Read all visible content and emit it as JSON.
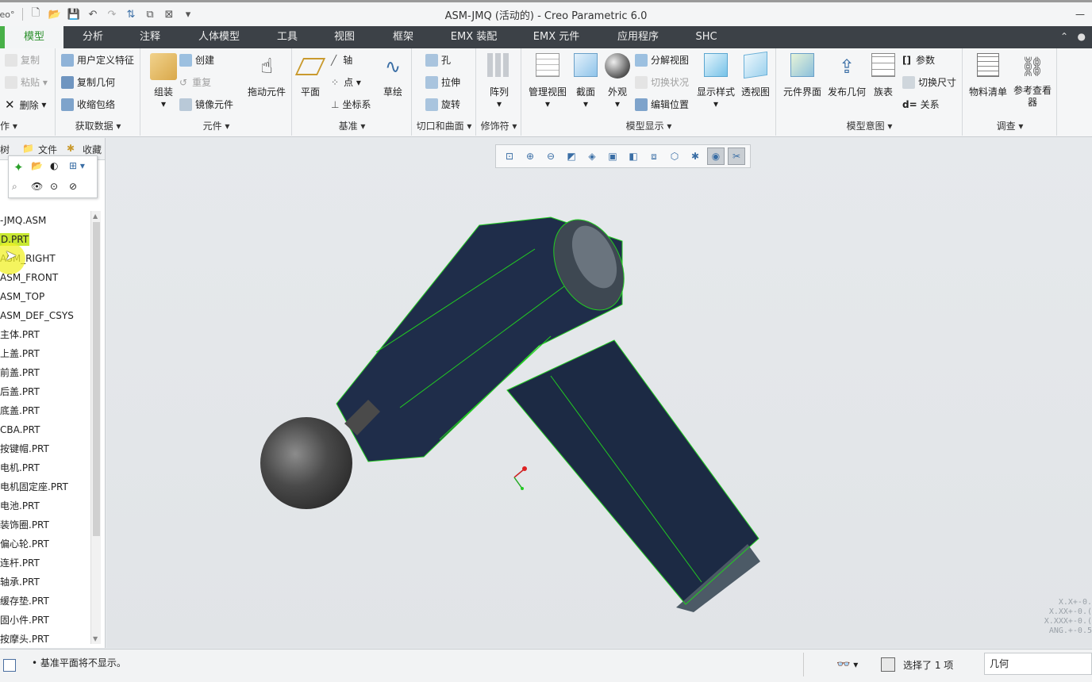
{
  "window": {
    "app_badge": "eo°",
    "title": "ASM-JMQ (活动的) - Creo Parametric 6.0"
  },
  "tabs": [
    "模型",
    "分析",
    "注释",
    "人体模型",
    "工具",
    "视图",
    "框架",
    "EMX 装配",
    "EMX 元件",
    "应用程序",
    "SHC"
  ],
  "ribbon": {
    "operations": {
      "copy": "复制",
      "paste": "粘贴",
      "delete": "删除",
      "label": "作"
    },
    "get_data": {
      "udf": "用户定义特征",
      "copy_geom": "复制几何",
      "shrinkwrap": "收缩包络",
      "label": "获取数据"
    },
    "component": {
      "assemble": "组装",
      "create": "创建",
      "repeat": "重复",
      "mirror": "镜像元件",
      "drag": "拖动元件",
      "label": "元件"
    },
    "datum": {
      "plane": "平面",
      "axis": "轴",
      "point": "点",
      "csys": "坐标系",
      "sketch": "草绘",
      "label": "基准"
    },
    "cut_surface": {
      "hole": "孔",
      "extrude": "拉伸",
      "revolve": "旋转",
      "label": "切口和曲面"
    },
    "modifiers": {
      "pattern": "阵列",
      "label": "修饰符"
    },
    "model_display": {
      "manage_views": "管理视图",
      "section": "截面",
      "appearance": "外观",
      "explode": "分解视图",
      "toggle_status": "切换状况",
      "edit_position": "编辑位置",
      "display_style": "显示样式",
      "perspective": "透视图",
      "label": "模型显示"
    },
    "model_intent": {
      "interface": "元件界面",
      "publish_geom": "发布几何",
      "family_table": "族表",
      "params": "参数",
      "switch_dims": "切换尺寸",
      "relations": "关系",
      "label": "模型意图"
    },
    "investigate": {
      "bom": "物料清单",
      "reference_viewer": "参考查看器",
      "label": "调查"
    }
  },
  "left_panel": {
    "tabs": [
      "树",
      "文件",
      "收藏"
    ],
    "tree_items": [
      "-JMQ.ASM",
      "D.PRT",
      "ASM_RIGHT",
      "ASM_FRONT",
      "ASM_TOP",
      "ASM_DEF_CSYS",
      "主体.PRT",
      "上盖.PRT",
      "前盖.PRT",
      "后盖.PRT",
      "底盖.PRT",
      "CBA.PRT",
      "按键帽.PRT",
      "电机.PRT",
      "电机固定座.PRT",
      "电池.PRT",
      "装饰圈.PRT",
      "偏心轮.PRT",
      "连杆.PRT",
      "轴承.PRT",
      "缓存垫.PRT",
      "固小件.PRT",
      "按摩头.PRT"
    ]
  },
  "graphics": {
    "readout": [
      "X.X+-0.",
      "X.XX+-0.(",
      "X.XXX+-0.(",
      "ANG.+-0.5"
    ]
  },
  "status": {
    "message": "基准平面将不显示。",
    "selection": "选择了 1 项",
    "filter": "几何"
  },
  "colors": {
    "accent": "#48b048",
    "tab_bar": "#3c4147",
    "model_body": "#1c2a44",
    "wire_edges": "#22cc22"
  }
}
